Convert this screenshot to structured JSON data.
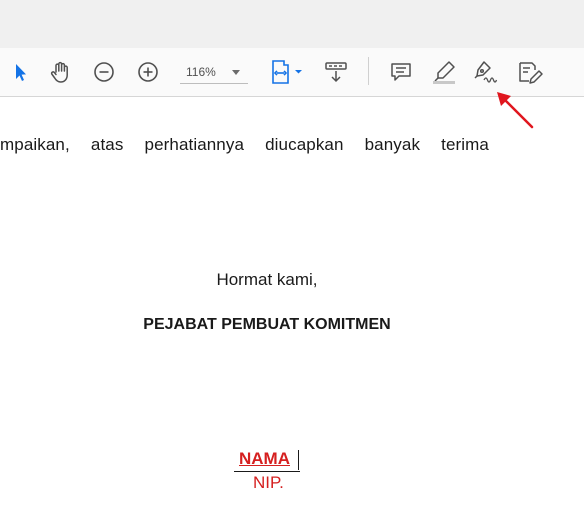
{
  "toolbar": {
    "tools": [
      {
        "name": "select-tool",
        "icon": "cursor-arrow-icon"
      },
      {
        "name": "hand-tool",
        "icon": "hand-icon"
      },
      {
        "name": "zoom-out-tool",
        "icon": "zoom-out-icon"
      },
      {
        "name": "zoom-in-tool",
        "icon": "zoom-in-icon"
      },
      {
        "name": "fit-page-tool",
        "icon": "fit-page-icon"
      },
      {
        "name": "scroll-mode-tool",
        "icon": "scroll-mode-icon"
      },
      {
        "name": "comment-tool",
        "icon": "comment-icon"
      },
      {
        "name": "highlight-tool",
        "icon": "highlighter-icon"
      },
      {
        "name": "draw-tool",
        "icon": "pen-draw-icon"
      },
      {
        "name": "fill-sign-tool",
        "icon": "fill-sign-icon"
      }
    ],
    "zoom": "116%",
    "accent_color": "#1473e6"
  },
  "document": {
    "line1": "mpaikan, atas perhatiannya diucapkan banyak terima",
    "closing": "Hormat kami,",
    "title": "PEJABAT PEMBUAT KOMITMEN",
    "name": "NAMA",
    "nip": "NIP.",
    "name_color": "#d51f1f"
  },
  "annotation": {
    "arrow_color": "#e0161e",
    "points_to": "draw-tool"
  }
}
